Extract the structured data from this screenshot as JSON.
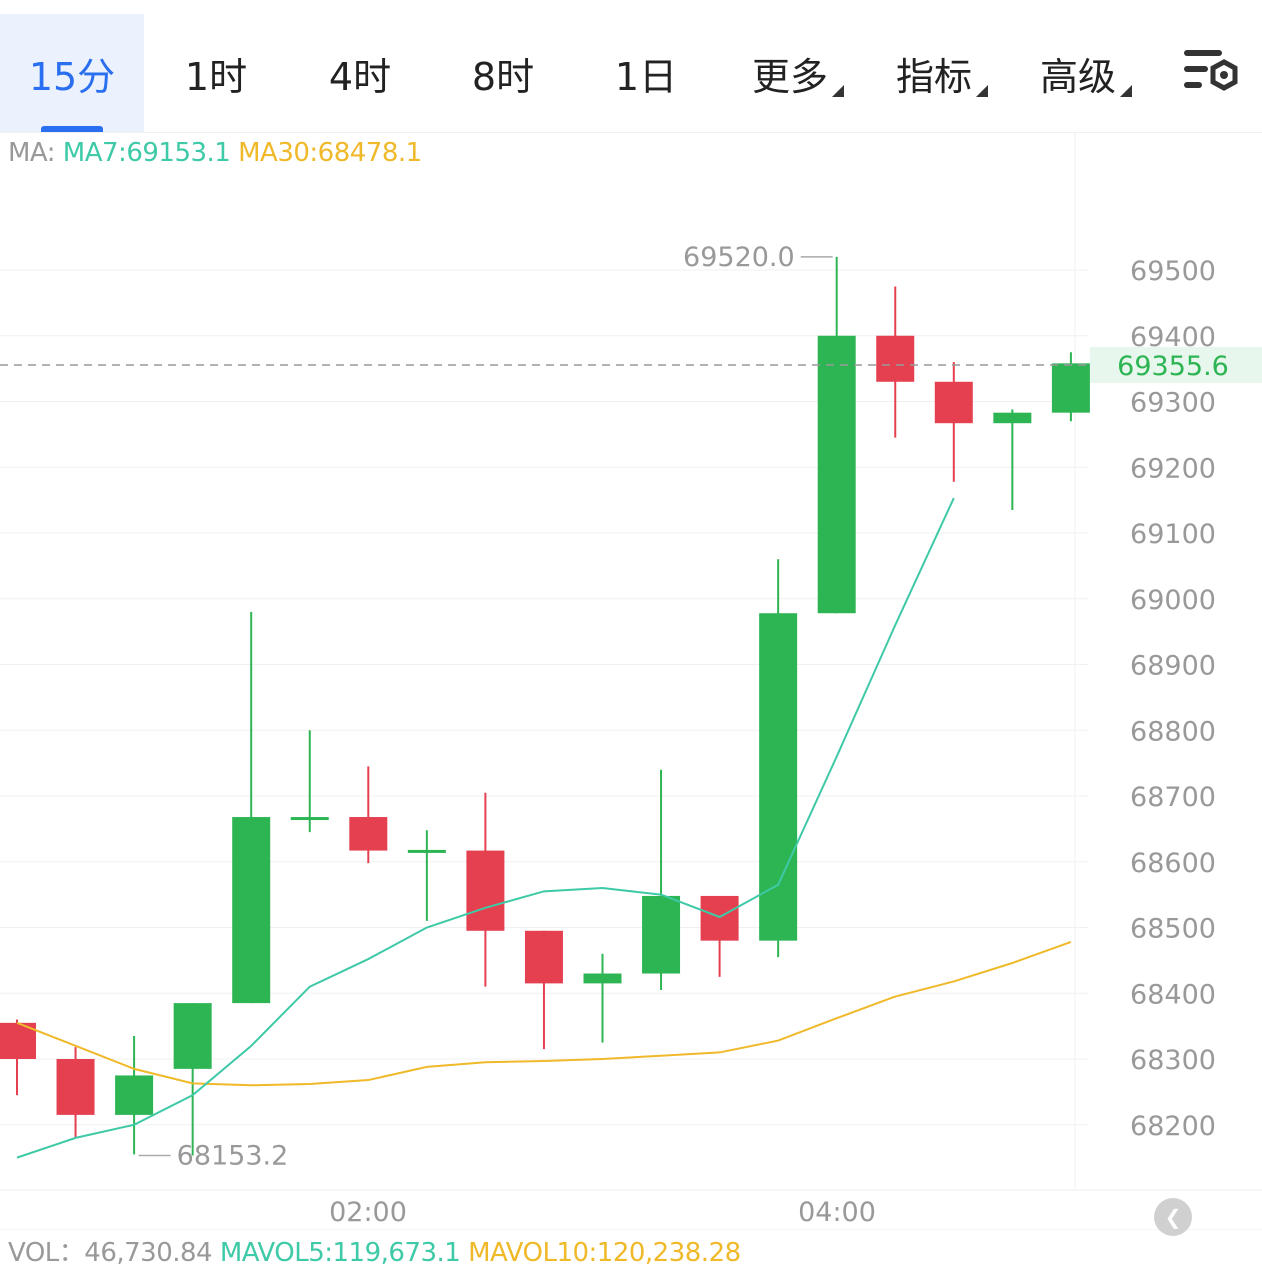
{
  "tabs": [
    {
      "label": "15分",
      "active": true,
      "dropdown": false
    },
    {
      "label": "1时",
      "active": false,
      "dropdown": false
    },
    {
      "label": "4时",
      "active": false,
      "dropdown": false
    },
    {
      "label": "8时",
      "active": false,
      "dropdown": false
    },
    {
      "label": "1日",
      "active": false,
      "dropdown": false
    },
    {
      "label": "更多",
      "active": false,
      "dropdown": true
    },
    {
      "label": "指标",
      "active": false,
      "dropdown": true
    },
    {
      "label": "高级",
      "active": false,
      "dropdown": true
    }
  ],
  "settings_icon": "chart-settings-icon",
  "ma_legend": {
    "prefix": "MA:",
    "ma7": "MA7:69153.1",
    "ma30": "MA30:68478.1"
  },
  "vol_legend": {
    "vol": "VOL：46,730.84",
    "mavol5": "MAVOL5:119,673.1",
    "mavol10": "MAVOL10:120,238.28"
  },
  "collapse_icon": "collapse-left-icon",
  "colors": {
    "up": "#2db553",
    "down": "#e5404f",
    "ma7": "#3ec9a7",
    "ma30": "#f0b92a",
    "accent": "#2a6ff0",
    "current_price": "#2db553"
  },
  "chart_data": {
    "type": "candlestick",
    "interval": "15分",
    "ylim": [
      68100,
      69700
    ],
    "y_ticks": [
      69500,
      69400,
      69300,
      69200,
      69100,
      69000,
      68900,
      68800,
      68700,
      68600,
      68500,
      68400,
      68300,
      68200
    ],
    "x_ticks": [
      "02:00",
      "04:00"
    ],
    "current_price": "69355.6",
    "high_label": "69520.0",
    "low_label": "68153.2",
    "candles": [
      {
        "open": 68355,
        "close": 68300,
        "high": 68360,
        "low": 68245
      },
      {
        "open": 68300,
        "close": 68215,
        "high": 68318,
        "low": 68180
      },
      {
        "open": 68215,
        "close": 68275,
        "high": 68335,
        "low": 68155
      },
      {
        "open": 68285,
        "close": 68385,
        "high": 68385,
        "low": 68153.2
      },
      {
        "open": 68385,
        "close": 68668,
        "high": 68980,
        "low": 68385
      },
      {
        "open": 68668,
        "close": 68668,
        "high": 68800,
        "low": 68645
      },
      {
        "open": 68668,
        "close": 68617,
        "high": 68745,
        "low": 68598
      },
      {
        "open": 68618,
        "close": 68618,
        "high": 68648,
        "low": 68510
      },
      {
        "open": 68617,
        "close": 68495,
        "high": 68705,
        "low": 68410
      },
      {
        "open": 68495,
        "close": 68415,
        "high": 68495,
        "low": 68315
      },
      {
        "open": 68415,
        "close": 68430,
        "high": 68460,
        "low": 68325
      },
      {
        "open": 68430,
        "close": 68548,
        "high": 68740,
        "low": 68405
      },
      {
        "open": 68548,
        "close": 68480,
        "high": 68548,
        "low": 68425
      },
      {
        "open": 68480,
        "close": 68978,
        "high": 69060,
        "low": 68455
      },
      {
        "open": 68978,
        "close": 69400,
        "high": 69520,
        "low": 68978
      },
      {
        "open": 69400,
        "close": 69330,
        "high": 69475,
        "low": 69245
      },
      {
        "open": 69330,
        "close": 69267,
        "high": 69360,
        "low": 69178
      },
      {
        "open": 69267,
        "close": 69283,
        "high": 69288,
        "low": 69135
      },
      {
        "open": 69283,
        "close": 69358,
        "high": 69375,
        "low": 69270
      }
    ],
    "ma7": [
      68150,
      68180,
      68200,
      68245,
      68320,
      68410,
      68452,
      68500,
      68530,
      68555,
      68560,
      68550,
      68516,
      68565,
      68760,
      68960,
      69153.1
    ],
    "ma7_start_index": 0,
    "ma30": [
      68355,
      68320,
      68285,
      68263,
      68260,
      68262,
      68268,
      68288,
      68295,
      68297,
      68300,
      68305,
      68310,
      68328,
      68362,
      68395,
      68418,
      68446,
      68478.1
    ],
    "ma30_start_index": 0
  }
}
